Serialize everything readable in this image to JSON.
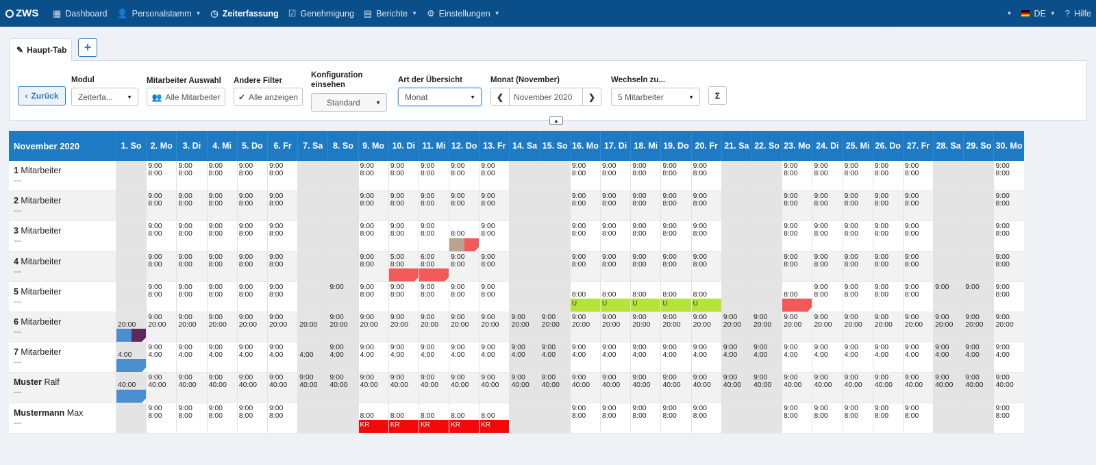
{
  "nav": {
    "brand": "ZWS",
    "items": [
      {
        "label": "Dashboard",
        "icon": "grid-icon",
        "glyph": "▦",
        "caret": false,
        "active": false
      },
      {
        "label": "Personalstamm",
        "icon": "user-icon",
        "glyph": "👤",
        "caret": true,
        "active": false
      },
      {
        "label": "Zeiterfassung",
        "icon": "clock-icon",
        "glyph": "◷",
        "caret": false,
        "active": true
      },
      {
        "label": "Genehmigung",
        "icon": "check-square-icon",
        "glyph": "☑",
        "caret": false,
        "active": false
      },
      {
        "label": "Berichte",
        "icon": "report-icon",
        "glyph": "▤",
        "caret": true,
        "active": false
      },
      {
        "label": "Einstellungen",
        "icon": "gear-icon",
        "glyph": "⚙",
        "caret": true,
        "active": false
      }
    ],
    "language": "DE",
    "help": "Hilfe"
  },
  "tabs": {
    "main": "Haupt-Tab",
    "add": "+"
  },
  "filters": {
    "back": "Zurück",
    "modul_label": "Modul",
    "modul_value": "Zeiterfa...",
    "mitarbeiter_label": "Mitarbeiter Auswahl",
    "mitarbeiter_value": "Alle Mitarbeiter",
    "andere_label": "Andere Filter",
    "andere_value": "Alle anzeigen",
    "konfig_label": "Konfiguration einsehen",
    "konfig_value": "Standard",
    "art_label": "Art der Übersicht",
    "art_value": "Monat",
    "monat_label": "Monat (November)",
    "monat_value": "November 2020",
    "wechseln_label": "Wechseln zu...",
    "wechseln_value": "5 Mitarbeiter",
    "sum": "Σ"
  },
  "grid": {
    "month_title": "November 2020",
    "days": [
      "1. So",
      "2. Mo",
      "3. Di",
      "4. Mi",
      "5. Do",
      "6. Fr",
      "7. Sa",
      "8. So",
      "9. Mo",
      "10. Di",
      "11. Mi",
      "12. Do",
      "13. Fr",
      "14. Sa",
      "15. So",
      "16. Mo",
      "17. Di",
      "18. Mi",
      "19. Do",
      "20. Fr",
      "21. Sa",
      "22. So",
      "23. Mo",
      "24. Di",
      "25. Mi",
      "26. Do",
      "27. Fr",
      "28. Sa",
      "29. So",
      "30. Mo"
    ],
    "weekend": [
      0,
      6,
      7,
      13,
      14,
      20,
      21,
      27,
      28
    ],
    "rows": [
      {
        "bold": "1",
        "name": " Mitarbeiter",
        "sub": "---",
        "cells": {
          "1": "9:00|8:00",
          "2": "9:00|8:00",
          "3": "9:00|8:00",
          "4": "9:00|8:00",
          "5": "9:00|8:00",
          "8": "9:00|8:00",
          "9": "9:00|8:00",
          "10": "9:00|8:00",
          "11": "9:00|8:00",
          "12": "9:00|8:00",
          "15": "9:00|8:00",
          "16": "9:00|8:00",
          "17": "9:00|8:00",
          "18": "9:00|8:00",
          "19": "9:00|8:00",
          "22": "9:00|8:00",
          "23": "9:00|8:00",
          "24": "9:00|8:00",
          "25": "9:00|8:00",
          "26": "9:00|8:00",
          "29": "9:00|8:00"
        }
      },
      {
        "bold": "2",
        "name": " Mitarbeiter",
        "sub": "---",
        "cells": {
          "1": "9:00|8:00",
          "2": "9:00|8:00",
          "3": "9:00|8:00",
          "4": "9:00|8:00",
          "5": "9:00|8:00",
          "8": "9:00|8:00",
          "9": "9:00|8:00",
          "10": "9:00|8:00",
          "11": "9:00|8:00",
          "12": "9:00|8:00",
          "15": "9:00|8:00",
          "16": "9:00|8:00",
          "17": "9:00|8:00",
          "18": "9:00|8:00",
          "19": "9:00|8:00",
          "22": "9:00|8:00",
          "23": "9:00|8:00",
          "24": "9:00|8:00",
          "25": "9:00|8:00",
          "26": "9:00|8:00",
          "29": "9:00|8:00"
        }
      },
      {
        "bold": "3",
        "name": " Mitarbeiter",
        "sub": "---",
        "cells": {
          "1": "9:00|8:00",
          "2": "9:00|8:00",
          "3": "9:00|8:00",
          "4": "9:00|8:00",
          "5": "9:00|8:00",
          "8": "9:00|8:00",
          "9": "9:00|8:00",
          "10": "9:00|8:00",
          "11": "|8:00",
          "12": "9:00|8:00",
          "15": "9:00|8:00",
          "16": "9:00|8:00",
          "17": "9:00|8:00",
          "18": "9:00|8:00",
          "19": "9:00|8:00",
          "22": "9:00|8:00",
          "23": "9:00|8:00",
          "24": "9:00|8:00",
          "25": "9:00|8:00",
          "26": "9:00|8:00",
          "29": "9:00|8:00"
        },
        "bars": [
          {
            "day": 11,
            "color": "#b6a48f",
            "half": "left",
            "label": ""
          },
          {
            "day": 11,
            "color": "#f25a5a",
            "half": "right",
            "label": "",
            "tri": true
          }
        ]
      },
      {
        "bold": "4",
        "name": " Mitarbeiter",
        "sub": "---",
        "cells": {
          "1": "9:00|8:00",
          "2": "9:00|8:00",
          "3": "9:00|8:00",
          "4": "9:00|8:00",
          "5": "9:00|8:00",
          "8": "9:00|8:00",
          "9": "5:00|8:00",
          "10": "6:00|8:00",
          "11": "9:00|8:00",
          "12": "9:00|8:00",
          "15": "9:00|8:00",
          "16": "9:00|8:00",
          "17": "9:00|8:00",
          "18": "9:00|8:00",
          "19": "9:00|8:00",
          "22": "9:00|8:00",
          "23": "9:00|8:00",
          "24": "9:00|8:00",
          "25": "9:00|8:00",
          "26": "9:00|8:00",
          "29": "9:00|8:00"
        },
        "bars": [
          {
            "day": 9,
            "color": "#f25a5a",
            "label": "",
            "tri": true
          },
          {
            "day": 10,
            "color": "#f25a5a",
            "label": "",
            "tri": true
          }
        ]
      },
      {
        "bold": "5",
        "name": " Mitarbeiter",
        "sub": "---",
        "cells": {
          "1": "9:00|8:00",
          "2": "9:00|8:00",
          "3": "9:00|8:00",
          "4": "9:00|8:00",
          "5": "9:00|8:00",
          "7": "9:00|",
          "8": "9:00|8:00",
          "9": "9:00|8:00",
          "10": "9:00|8:00",
          "11": "9:00|8:00",
          "12": "9:00|8:00",
          "15": "|8:00",
          "16": "|8:00",
          "17": "|8:00",
          "18": "|8:00",
          "19": "|8:00",
          "22": "|8:00",
          "23": "9:00|8:00",
          "24": "9:00|8:00",
          "25": "9:00|8:00",
          "26": "9:00|8:00",
          "27": "9:00|",
          "28": "9:00|",
          "29": "9:00|8:00"
        },
        "bars": [
          {
            "day": 15,
            "color": "#b4e33a",
            "label": "U",
            "green": true
          },
          {
            "day": 16,
            "color": "#b4e33a",
            "label": "U",
            "green": true
          },
          {
            "day": 17,
            "color": "#b4e33a",
            "label": "U",
            "green": true
          },
          {
            "day": 18,
            "color": "#b4e33a",
            "label": "U",
            "green": true
          },
          {
            "day": 19,
            "color": "#b4e33a",
            "label": "U",
            "green": true
          },
          {
            "day": 22,
            "color": "#f25a5a",
            "label": "",
            "tri": true
          }
        ]
      },
      {
        "bold": "6",
        "name": " Mitarbeiter",
        "sub": "---",
        "cells": {
          "0": "|20:00",
          "1": "9:00|20:00",
          "2": "9:00|20:00",
          "3": "9:00|20:00",
          "4": "9:00|20:00",
          "5": "9:00|20:00",
          "6": "|20:00",
          "7": "9:00|20:00",
          "8": "9:00|20:00",
          "9": "9:00|20:00",
          "10": "9:00|20:00",
          "11": "9:00|20:00",
          "12": "9:00|20:00",
          "13": "9:00|20:00",
          "14": "9:00|20:00",
          "15": "9:00|20:00",
          "16": "9:00|20:00",
          "17": "9:00|20:00",
          "18": "9:00|20:00",
          "19": "9:00|20:00",
          "20": "9:00|20:00",
          "21": "9:00|20:00",
          "22": "9:00|20:00",
          "23": "9:00|20:00",
          "24": "9:00|20:00",
          "25": "9:00|20:00",
          "26": "9:00|20:00",
          "27": "9:00|20:00",
          "28": "9:00|20:00",
          "29": "9:00|20:00"
        },
        "bars": [
          {
            "day": 0,
            "color": "#4a8fd0",
            "half": "left",
            "label": ""
          },
          {
            "day": 0,
            "color": "#5a2a5a",
            "half": "right",
            "label": "",
            "tri": true
          }
        ]
      },
      {
        "bold": "7",
        "name": " Mitarbeiter",
        "sub": "---",
        "cells": {
          "0": "|4:00",
          "1": "9:00|4:00",
          "2": "9:00|4:00",
          "3": "9:00|4:00",
          "4": "9:00|4:00",
          "5": "9:00|4:00",
          "6": "|4:00",
          "7": "9:00|4:00",
          "8": "9:00|4:00",
          "9": "9:00|4:00",
          "10": "9:00|4:00",
          "11": "9:00|4:00",
          "12": "9:00|4:00",
          "13": "9:00|4:00",
          "14": "9:00|4:00",
          "15": "9:00|4:00",
          "16": "9:00|4:00",
          "17": "9:00|4:00",
          "18": "9:00|4:00",
          "19": "9:00|4:00",
          "20": "9:00|4:00",
          "21": "9:00|4:00",
          "22": "9:00|4:00",
          "23": "9:00|4:00",
          "24": "9:00|4:00",
          "25": "9:00|4:00",
          "26": "9:00|4:00",
          "27": "9:00|4:00",
          "28": "9:00|4:00",
          "29": "9:00|4:00"
        },
        "bars": [
          {
            "day": 0,
            "color": "#4a8fd0",
            "label": "",
            "tri": true
          }
        ]
      },
      {
        "bold": "Muster",
        "name": " Ralf",
        "sub": "---",
        "cells": {
          "0": "|40:00",
          "1": "9:00|40:00",
          "2": "9:00|40:00",
          "3": "9:00|40:00",
          "4": "9:00|40:00",
          "5": "9:00|40:00",
          "6": "9:00|40:00",
          "7": "9:00|40:00",
          "8": "9:00|40:00",
          "9": "9:00|40:00",
          "10": "9:00|40:00",
          "11": "9:00|40:00",
          "12": "9:00|40:00",
          "13": "9:00|40:00",
          "14": "9:00|40:00",
          "15": "9:00|40:00",
          "16": "9:00|40:00",
          "17": "9:00|40:00",
          "18": "9:00|40:00",
          "19": "9:00|40:00",
          "20": "9:00|40:00",
          "21": "9:00|40:00",
          "22": "9:00|40:00",
          "23": "9:00|40:00",
          "24": "9:00|40:00",
          "25": "9:00|40:00",
          "26": "9:00|40:00",
          "27": "9:00|40:00",
          "28": "9:00|40:00",
          "29": "9:00|40:00"
        },
        "bars": [
          {
            "day": 0,
            "color": "#4a8fd0",
            "label": "",
            "tri": true
          }
        ]
      },
      {
        "bold": "Mustermann",
        "name": " Max",
        "sub": "---",
        "cells": {
          "1": "9:00|8:00",
          "2": "9:00|8:00",
          "3": "9:00|8:00",
          "4": "9:00|8:00",
          "5": "9:00|8:00",
          "8": "|8:00",
          "9": "|8:00",
          "10": "|8:00",
          "11": "|8:00",
          "12": "|8:00",
          "15": "9:00|8:00",
          "16": "9:00|8:00",
          "17": "9:00|8:00",
          "18": "9:00|8:00",
          "19": "9:00|8:00",
          "22": "9:00|8:00",
          "23": "9:00|8:00",
          "24": "9:00|8:00",
          "25": "9:00|8:00",
          "26": "9:00|8:00",
          "29": "9:00|8:00"
        },
        "bars": [
          {
            "day": 8,
            "color": "#f20a0a",
            "label": "KR"
          },
          {
            "day": 9,
            "color": "#f20a0a",
            "label": "KR"
          },
          {
            "day": 10,
            "color": "#f20a0a",
            "label": "KR"
          },
          {
            "day": 11,
            "color": "#f20a0a",
            "label": "KR"
          },
          {
            "day": 12,
            "color": "#f20a0a",
            "label": "KR"
          }
        ]
      }
    ]
  }
}
